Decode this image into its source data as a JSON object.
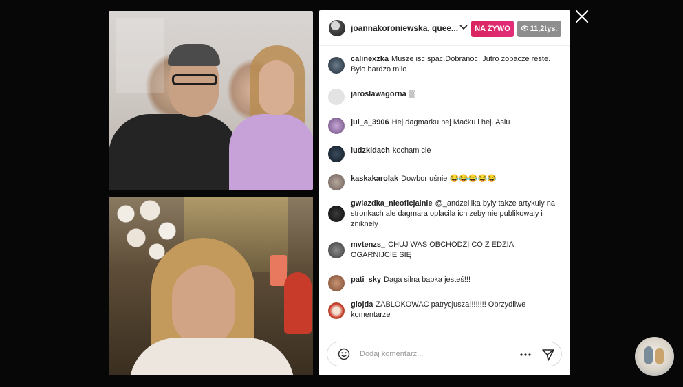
{
  "header": {
    "host_name": "joannakoroniewska, quee...",
    "live_label": "NA ŻYWO",
    "viewer_count": "11,2tys."
  },
  "comments": [
    {
      "user": "calinexzka",
      "text": "Musze isc spac.Dobranoc. Jutro zobacze reste. Bylo bardzo milo"
    },
    {
      "user": "jaroslawagorna",
      "text": "▒"
    },
    {
      "user": "jul_a_3906",
      "text": "Hej dagmarku hej Maćku i hej. Asiu"
    },
    {
      "user": "ludzkidach",
      "text": "kocham cie"
    },
    {
      "user": "kaskakarolak",
      "text": "Dowbor uśnie 😂😂😂😂😂"
    },
    {
      "user": "gwiazdka_nieoficjalnie",
      "text": "@_andzellika byly takze artykuly na stronkach ale dagmara oplacila ich zeby nie publikowaly i zniknely"
    },
    {
      "user": "mvtenzs_",
      "text": "CHUJ WAS OBCHODZI CO Z EDZIA OGARNIJCIE SIĘ"
    },
    {
      "user": "pati_sky",
      "text": "Daga silna babka jesteś!!!"
    },
    {
      "user": "glojda",
      "text": "ZABLOKOWAĆ patrycjusza!!!!!!!! Obrzydliwe komentarze"
    }
  ],
  "composer": {
    "placeholder": "Dodaj komentarz..."
  },
  "icons": {
    "close": "close-icon",
    "emoji": "emoji-icon",
    "more": "more-icon",
    "send": "send-icon",
    "chevron": "chevron-down-icon",
    "eye": "eye-icon"
  },
  "colors": {
    "live_badge": "#e22e7a",
    "viewer_badge": "#8e8e8e",
    "background": "#070707"
  }
}
